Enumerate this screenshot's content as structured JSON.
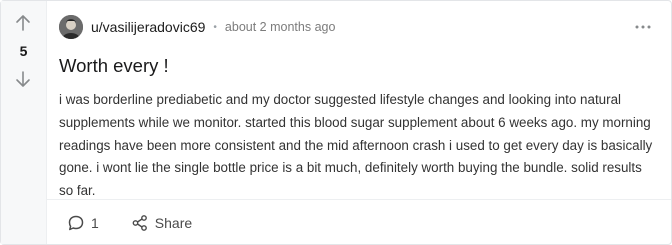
{
  "post": {
    "score": "5",
    "author": "u/vasilijeradovic69",
    "separator": "•",
    "time": "about 2 months ago",
    "title": "Worth every !",
    "body": "i was borderline prediabetic and my doctor suggested lifestyle changes and looking into natural supplements while we monitor. started this blood sugar supplement about 6 weeks ago. my morning readings have been more consistent and the mid afternoon crash i used to get every day is basically gone. i wont lie the single bottle price is a bit much, definitely worth buying the bundle. solid results so far.",
    "comment_count": "1",
    "share_label": "Share"
  },
  "icons": {
    "upvote": "arrow-up-icon",
    "downvote": "arrow-down-icon",
    "more": "more-options-icon",
    "comment": "comment-bubble-icon",
    "share": "share-icon"
  },
  "colors": {
    "vote_column_bg": "#f7f8f9",
    "text": "#1a1a1b",
    "muted": "#7c7c7c"
  }
}
